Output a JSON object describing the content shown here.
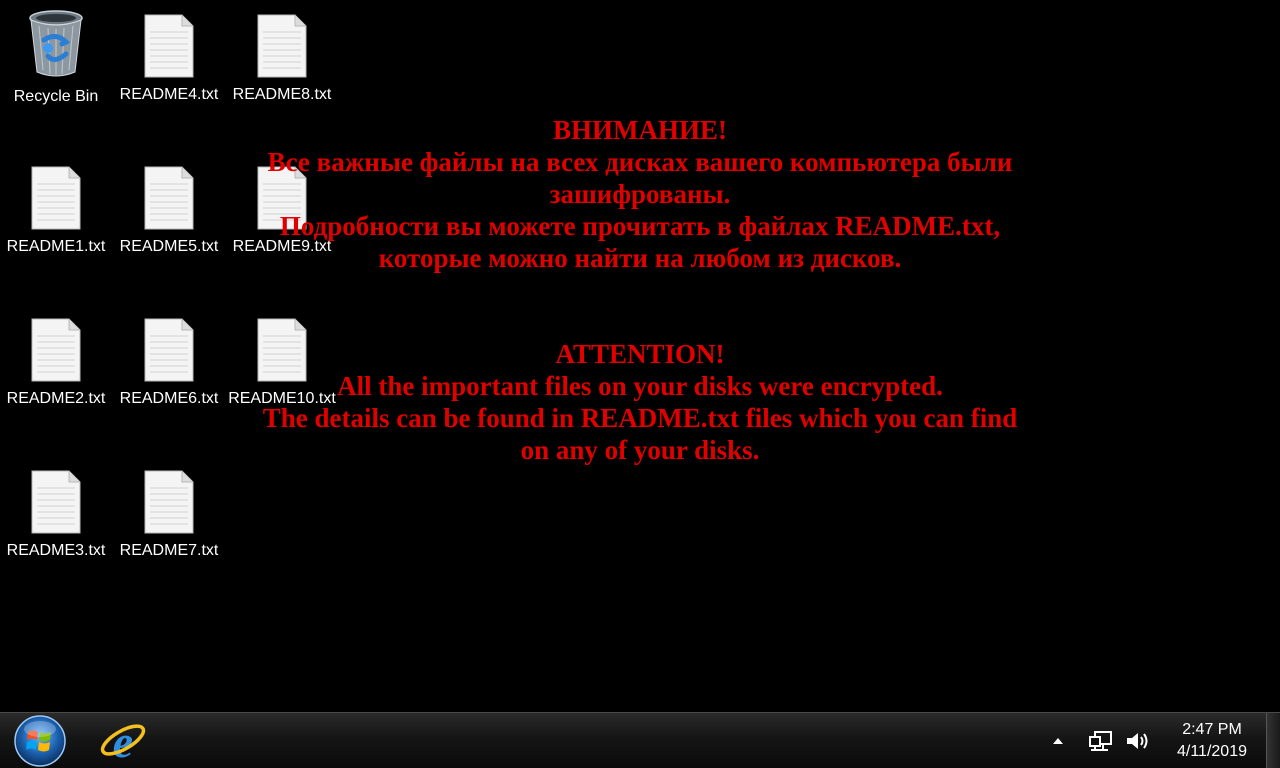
{
  "desktop": {
    "icons": [
      {
        "label": "Recycle Bin",
        "icon": "recycle-bin-icon"
      },
      {
        "label": "README4.txt",
        "icon": "text-file-icon"
      },
      {
        "label": "README8.txt",
        "icon": "text-file-icon"
      },
      {
        "label": "README1.txt",
        "icon": "text-file-icon"
      },
      {
        "label": "README5.txt",
        "icon": "text-file-icon"
      },
      {
        "label": "README9.txt",
        "icon": "text-file-icon"
      },
      {
        "label": "README2.txt",
        "icon": "text-file-icon"
      },
      {
        "label": "README6.txt",
        "icon": "text-file-icon"
      },
      {
        "label": "README10.txt",
        "icon": "text-file-icon"
      },
      {
        "label": "README3.txt",
        "icon": "text-file-icon"
      },
      {
        "label": "README7.txt",
        "icon": "text-file-icon"
      }
    ]
  },
  "message": {
    "color": "#e00000",
    "ru": [
      "ВНИМАНИЕ!",
      "Все важные файлы на всех дисках вашего компьютера были",
      "зашифрованы.",
      "Подробности вы можете прочитать в файлах README.txt,",
      "которые можно найти на любом из дисков."
    ],
    "en": [
      "ATTENTION!",
      "All the important files on your disks were encrypted.",
      "The details can be found in README.txt files which you can find",
      "on any of your disks."
    ]
  },
  "taskbar": {
    "start_icon": "windows-orb-icon",
    "pinned": [
      {
        "name": "Internet Explorer",
        "icon": "internet-explorer-icon"
      }
    ],
    "tray": {
      "icons": [
        "show-hidden-icons-arrow",
        "network-icon",
        "volume-icon"
      ],
      "time": "2:47 PM",
      "date": "4/11/2019"
    }
  }
}
